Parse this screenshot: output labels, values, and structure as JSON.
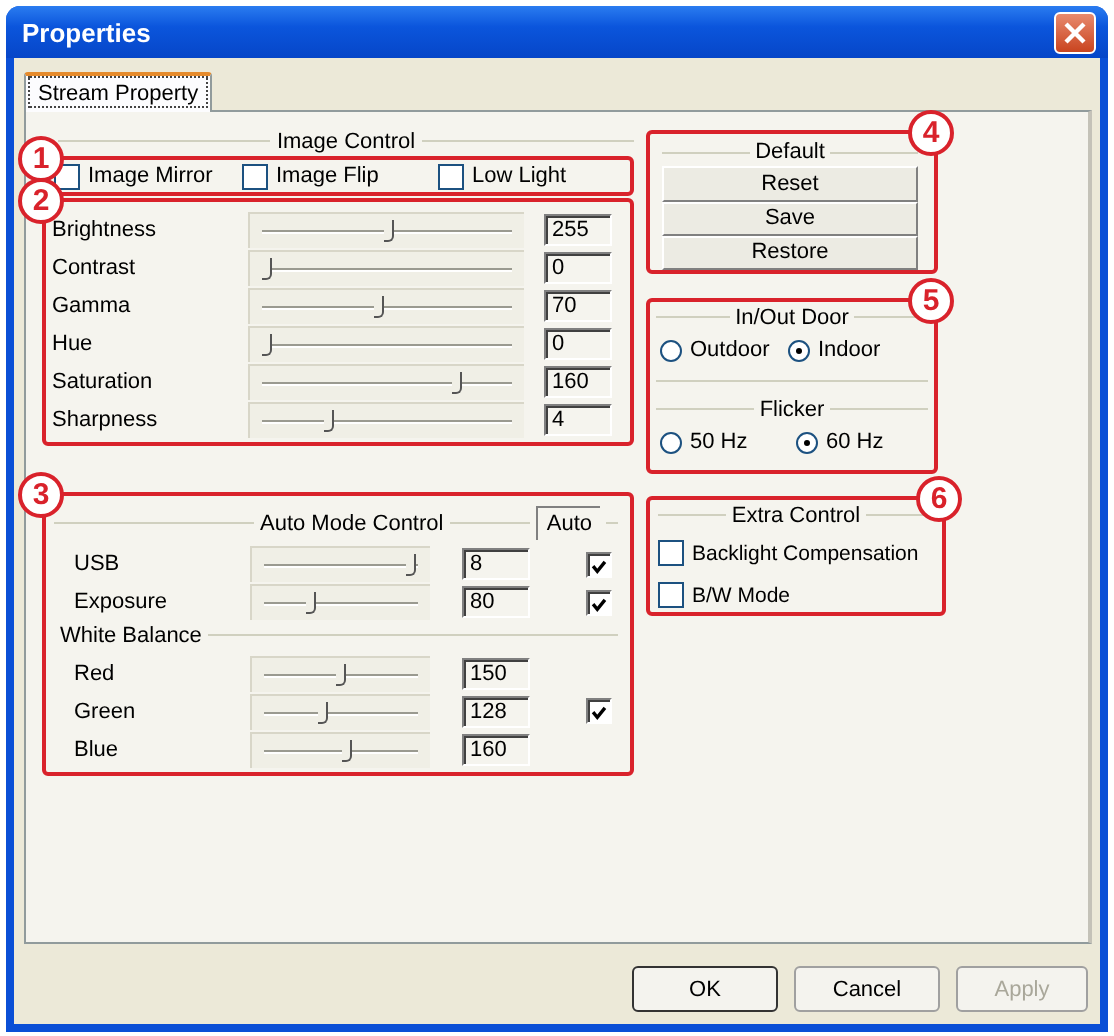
{
  "window": {
    "title": "Properties"
  },
  "tabs": [
    {
      "label": "Stream Property",
      "selected": true
    }
  ],
  "image_control": {
    "callout": "1",
    "title": "Image Control",
    "options": [
      {
        "label": "Image Mirror",
        "checked": false
      },
      {
        "label": "Image Flip",
        "checked": false
      },
      {
        "label": "Low Light",
        "checked": false
      }
    ]
  },
  "adjustments": {
    "callout": "2",
    "sliders": [
      {
        "name": "Brightness",
        "level": 0.51,
        "value": "255"
      },
      {
        "name": "Contrast",
        "level": 0.0,
        "value": "0"
      },
      {
        "name": "Gamma",
        "level": 0.47,
        "value": "70"
      },
      {
        "name": "Hue",
        "level": 0.0,
        "value": "0"
      },
      {
        "name": "Saturation",
        "level": 0.8,
        "value": "160"
      },
      {
        "name": "Sharpness",
        "level": 0.26,
        "value": "4"
      }
    ]
  },
  "auto_mode": {
    "callout": "3",
    "title": "Auto Mode Control",
    "auto_header": "Auto",
    "sliders": [
      {
        "name": "USB",
        "level": 1.0,
        "value": "8",
        "auto": true
      },
      {
        "name": "Exposure",
        "level": 0.3,
        "value": "80",
        "auto": true
      }
    ],
    "white_balance": {
      "title": "White Balance",
      "sliders": [
        {
          "name": "Red",
          "level": 0.5,
          "value": "150"
        },
        {
          "name": "Green",
          "level": 0.38,
          "value": "128",
          "auto": true
        },
        {
          "name": "Blue",
          "level": 0.55,
          "value": "160"
        }
      ]
    }
  },
  "default": {
    "callout": "4",
    "title": "Default",
    "buttons": [
      "Reset",
      "Save",
      "Restore"
    ]
  },
  "in_out_door": {
    "callout": "5",
    "title": "In/Out Door",
    "options": [
      {
        "label": "Outdoor",
        "selected": false
      },
      {
        "label": "Indoor",
        "selected": true
      }
    ],
    "flicker": {
      "title": "Flicker",
      "options": [
        {
          "label": "50 Hz",
          "selected": false
        },
        {
          "label": "60 Hz",
          "selected": true
        }
      ]
    }
  },
  "extra_control": {
    "callout": "6",
    "title": "Extra Control",
    "options": [
      {
        "label": "Backlight Compensation",
        "checked": false
      },
      {
        "label": "B/W Mode",
        "checked": false
      }
    ]
  },
  "buttons": [
    {
      "label": "OK",
      "disabled": false
    },
    {
      "label": "Cancel",
      "disabled": false
    },
    {
      "label": "Apply",
      "disabled": true
    }
  ]
}
